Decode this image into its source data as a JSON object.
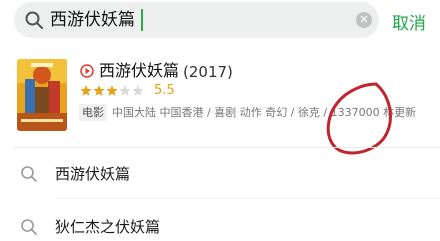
{
  "search": {
    "query": "西游伏妖篇",
    "cancel_label": "取消",
    "clear_symbol": "✕"
  },
  "result": {
    "title": "西游伏妖篇",
    "year": "(2017)",
    "rating": "5.5",
    "rating_out_of_five": 3,
    "tag": "电影",
    "meta": "中国大陆 中国香港 / 喜剧 动作 奇幻 / 徐克 / 1337000 林更新"
  },
  "suggestions": [
    {
      "label": "西游伏妖篇",
      "icon": "search-icon"
    },
    {
      "label": "狄仁杰之伏妖篇",
      "icon": "search-icon"
    }
  ],
  "colors": {
    "accent": "#21a548",
    "star": "#e6a317",
    "play": "#e33b2f",
    "annotation": "#c0252d"
  }
}
